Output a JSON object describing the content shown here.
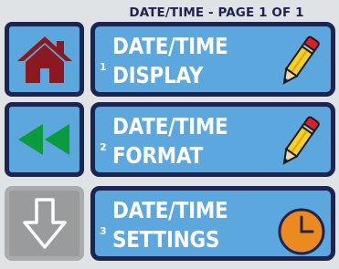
{
  "header": {
    "title": "DATE/TIME - PAGE 1 OF 1"
  },
  "nav": {
    "home": {
      "icon": "home-icon"
    },
    "back": {
      "icon": "double-left-arrow-icon"
    },
    "down": {
      "icon": "down-arrow-icon",
      "disabled": true
    }
  },
  "menu": [
    {
      "number": "1",
      "label": "DATE/TIME\nDISPLAY",
      "icon": "pencil-icon"
    },
    {
      "number": "2",
      "label": "DATE/TIME\nFORMAT",
      "icon": "pencil-icon"
    },
    {
      "number": "3",
      "label": "DATE/TIME\nSETTINGS",
      "icon": "clock-icon"
    }
  ],
  "colors": {
    "background": "#dfe3e6",
    "button_blue": "#5ba7de",
    "border_navy": "#1f2350",
    "home_red": "#8a1a1f",
    "arrow_green": "#0a9b3d",
    "disabled_gray": "#9a9b9d",
    "clock_orange": "#ec8a22",
    "pencil_yellow": "#f6cf2c"
  }
}
